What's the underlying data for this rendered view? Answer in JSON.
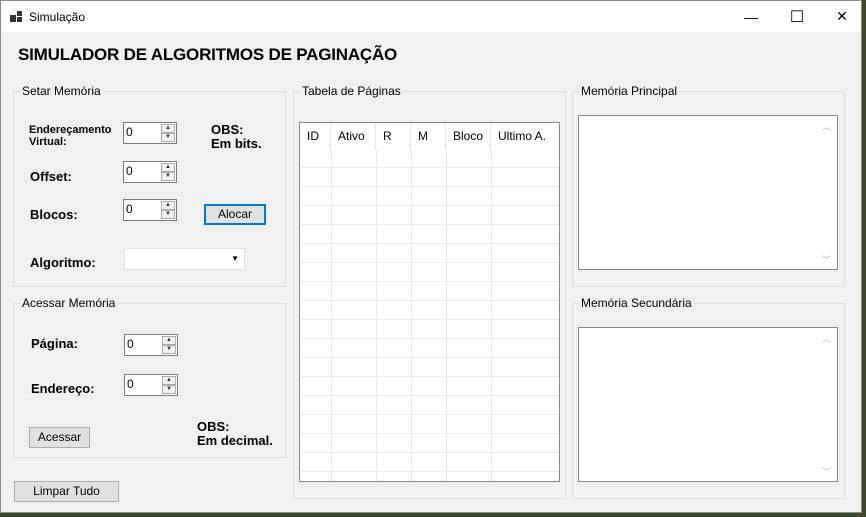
{
  "window": {
    "title": "Simulação",
    "minimize_glyph": "—",
    "maximize_glyph": "☐",
    "close_glyph": "✕"
  },
  "heading": "SIMULADOR DE ALGORITMOS DE PAGINAÇÃO",
  "setar_memoria": {
    "title": "Setar Memória",
    "enderecamento_label_1": "Endereçamento",
    "enderecamento_label_2": "Virtual:",
    "enderecamento_value": "0",
    "offset_label": "Offset:",
    "offset_value": "0",
    "blocos_label": "Blocos:",
    "blocos_value": "0",
    "algoritmo_label": "Algoritmo:",
    "algoritmo_value": "",
    "obs_1": "OBS:",
    "obs_2": "Em bits.",
    "alocar_label": "Alocar"
  },
  "acessar_memoria": {
    "title": "Acessar Memória",
    "pagina_label": "Página:",
    "pagina_value": "0",
    "endereco_label": "Endereço:",
    "endereco_value": "0",
    "obs_1": "OBS:",
    "obs_2": "Em decimal.",
    "acessar_label": "Acessar"
  },
  "limpar_label": "Limpar Tudo",
  "tabela": {
    "title": "Tabela de Páginas",
    "columns": [
      "ID",
      "Ativo",
      "R",
      "M",
      "Bloco",
      "Ultimo A."
    ]
  },
  "memoria_principal": {
    "title": "Memória Principal"
  },
  "memoria_secundaria": {
    "title": "Memória Secundária"
  },
  "icons": {
    "spin_up": "▲",
    "spin_down": "▼",
    "combo_arrow": "▼",
    "scroll_up": "︿",
    "scroll_down": "﹀"
  }
}
